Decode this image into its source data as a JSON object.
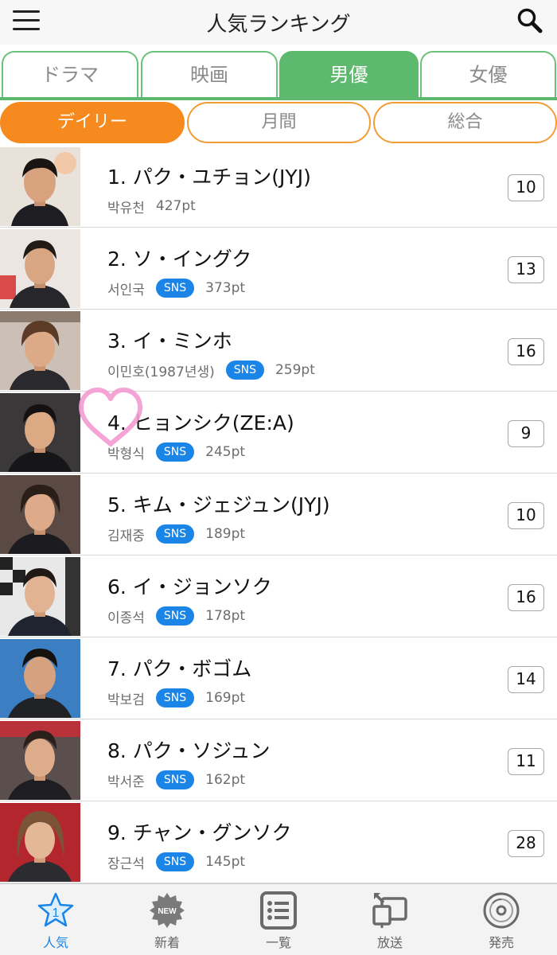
{
  "header": {
    "title": "人気ランキング"
  },
  "category_tabs": [
    {
      "label": "ドラマ",
      "active": false
    },
    {
      "label": "映画",
      "active": false
    },
    {
      "label": "男優",
      "active": true
    },
    {
      "label": "女優",
      "active": false
    }
  ],
  "period_tabs": [
    {
      "label": "デイリー",
      "active": true
    },
    {
      "label": "月間",
      "active": false
    },
    {
      "label": "総合",
      "active": false
    }
  ],
  "sns_label": "SNS",
  "rankings": [
    {
      "title": "1. パク・ユチョン(JYJ)",
      "korean": "박유천",
      "sns": false,
      "points": "427pt",
      "count": "10"
    },
    {
      "title": "2. ソ・イングク",
      "korean": "서인국",
      "sns": true,
      "points": "373pt",
      "count": "13"
    },
    {
      "title": "3. イ・ミンホ",
      "korean": "이민호(1987년생)",
      "sns": true,
      "points": "259pt",
      "count": "16"
    },
    {
      "title": "4. ヒョンシク(ZE:A)",
      "korean": "박형식",
      "sns": true,
      "points": "245pt",
      "count": "9"
    },
    {
      "title": "5. キム・ジェジュン(JYJ)",
      "korean": "김재중",
      "sns": true,
      "points": "189pt",
      "count": "10"
    },
    {
      "title": "6. イ・ジョンソク",
      "korean": "이종석",
      "sns": true,
      "points": "178pt",
      "count": "16"
    },
    {
      "title": "7. パク・ボゴム",
      "korean": "박보검",
      "sns": true,
      "points": "169pt",
      "count": "14"
    },
    {
      "title": "8. パク・ソジュン",
      "korean": "박서준",
      "sns": true,
      "points": "162pt",
      "count": "11"
    },
    {
      "title": "9. チャン・グンソク",
      "korean": "장근석",
      "sns": true,
      "points": "145pt",
      "count": "28"
    }
  ],
  "bottom_nav": [
    {
      "label": "人気",
      "icon": "ranking-star-icon",
      "active": true,
      "badge": "1"
    },
    {
      "label": "新着",
      "icon": "new-badge-icon",
      "active": false,
      "badge": "NEW"
    },
    {
      "label": "一覧",
      "icon": "list-icon",
      "active": false
    },
    {
      "label": "放送",
      "icon": "broadcast-icon",
      "active": false
    },
    {
      "label": "発売",
      "icon": "disc-icon",
      "active": false
    }
  ],
  "colors": {
    "green": "#5db96d",
    "orange": "#f68a1e",
    "blue": "#1a85e6",
    "heart": "#f39ad0"
  }
}
